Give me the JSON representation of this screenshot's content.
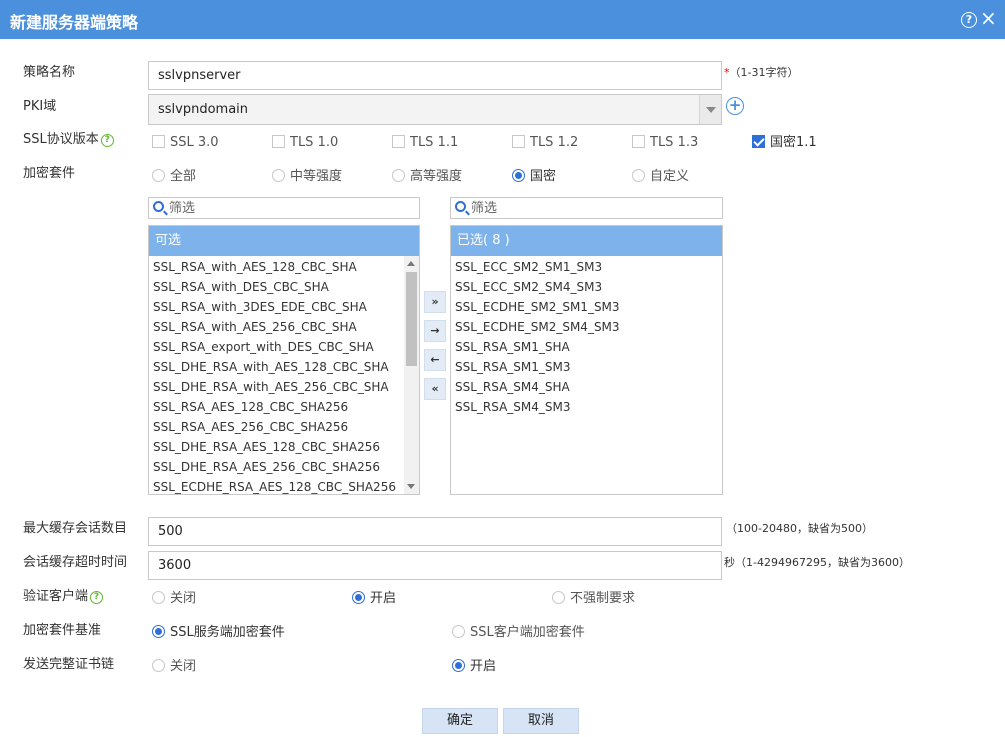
{
  "dialog": {
    "title": "新建服务器端策略",
    "help": "?",
    "close": "×"
  },
  "fields": {
    "policy_name": {
      "label": "策略名称",
      "value": "sslvpnserver",
      "required_mark": "*",
      "hint": "（1-31字符）"
    },
    "pki_domain": {
      "label": "PKI域",
      "value": "sslvpndomain",
      "add_icon": "+"
    },
    "ssl_version": {
      "label": "SSL协议版本",
      "help": "?",
      "options": [
        {
          "label": "SSL 3.0",
          "checked": false
        },
        {
          "label": "TLS 1.0",
          "checked": false
        },
        {
          "label": "TLS 1.1",
          "checked": false
        },
        {
          "label": "TLS 1.2",
          "checked": false
        },
        {
          "label": "TLS 1.3",
          "checked": false
        },
        {
          "label": "国密1.1",
          "checked": true
        }
      ]
    },
    "cipher_suite": {
      "label": "加密套件",
      "options": [
        {
          "label": "全部",
          "selected": false
        },
        {
          "label": "中等强度",
          "selected": false
        },
        {
          "label": "高等强度",
          "selected": false
        },
        {
          "label": "国密",
          "selected": true
        },
        {
          "label": "自定义",
          "selected": false
        }
      ]
    },
    "max_cache": {
      "label": "最大缓存会话数目",
      "value": "500",
      "hint": "（100-20480，缺省为500）"
    },
    "cache_timeout": {
      "label": "会话缓存超时时间",
      "value": "3600",
      "hint": "秒（1-4294967295，缺省为3600）"
    },
    "verify_client": {
      "label": "验证客户端",
      "help": "?",
      "options": [
        {
          "label": "关闭",
          "selected": false
        },
        {
          "label": "开启",
          "selected": true
        },
        {
          "label": "不强制要求",
          "selected": false
        }
      ]
    },
    "suite_basis": {
      "label": "加密套件基准",
      "options": [
        {
          "label": "SSL服务端加密套件",
          "selected": true
        },
        {
          "label": "SSL客户端加密套件",
          "selected": false
        }
      ]
    },
    "send_chain": {
      "label": "发送完整证书链",
      "options": [
        {
          "label": "关闭",
          "selected": false
        },
        {
          "label": "开启",
          "selected": true
        }
      ]
    }
  },
  "transfer": {
    "filter_placeholder": "筛选",
    "available": {
      "header": "可选",
      "items": [
        "SSL_RSA_with_AES_128_CBC_SHA",
        "SSL_RSA_with_DES_CBC_SHA",
        "SSL_RSA_with_3DES_EDE_CBC_SHA",
        "SSL_RSA_with_AES_256_CBC_SHA",
        "SSL_RSA_export_with_DES_CBC_SHA",
        "SSL_DHE_RSA_with_AES_128_CBC_SHA",
        "SSL_DHE_RSA_with_AES_256_CBC_SHA",
        "SSL_RSA_AES_128_CBC_SHA256",
        "SSL_RSA_AES_256_CBC_SHA256",
        "SSL_DHE_RSA_AES_128_CBC_SHA256",
        "SSL_DHE_RSA_AES_256_CBC_SHA256",
        "SSL_ECDHE_RSA_AES_128_CBC_SHA256"
      ]
    },
    "selected": {
      "header": "已选( 8 )",
      "items": [
        "SSL_ECC_SM2_SM1_SM3",
        "SSL_ECC_SM2_SM4_SM3",
        "SSL_ECDHE_SM2_SM1_SM3",
        "SSL_ECDHE_SM2_SM4_SM3",
        "SSL_RSA_SM1_SHA",
        "SSL_RSA_SM1_SM3",
        "SSL_RSA_SM4_SHA",
        "SSL_RSA_SM4_SM3"
      ]
    },
    "buttons": {
      "add_all": "»",
      "add": "→",
      "remove": "←",
      "remove_all": "«"
    }
  },
  "actions": {
    "ok": "确定",
    "cancel": "取消"
  },
  "colors": {
    "titlebar": "#4a90dc",
    "list_header": "#7db2ea",
    "accent": "#2f6fd8",
    "help_icon": "#5cb82e"
  }
}
